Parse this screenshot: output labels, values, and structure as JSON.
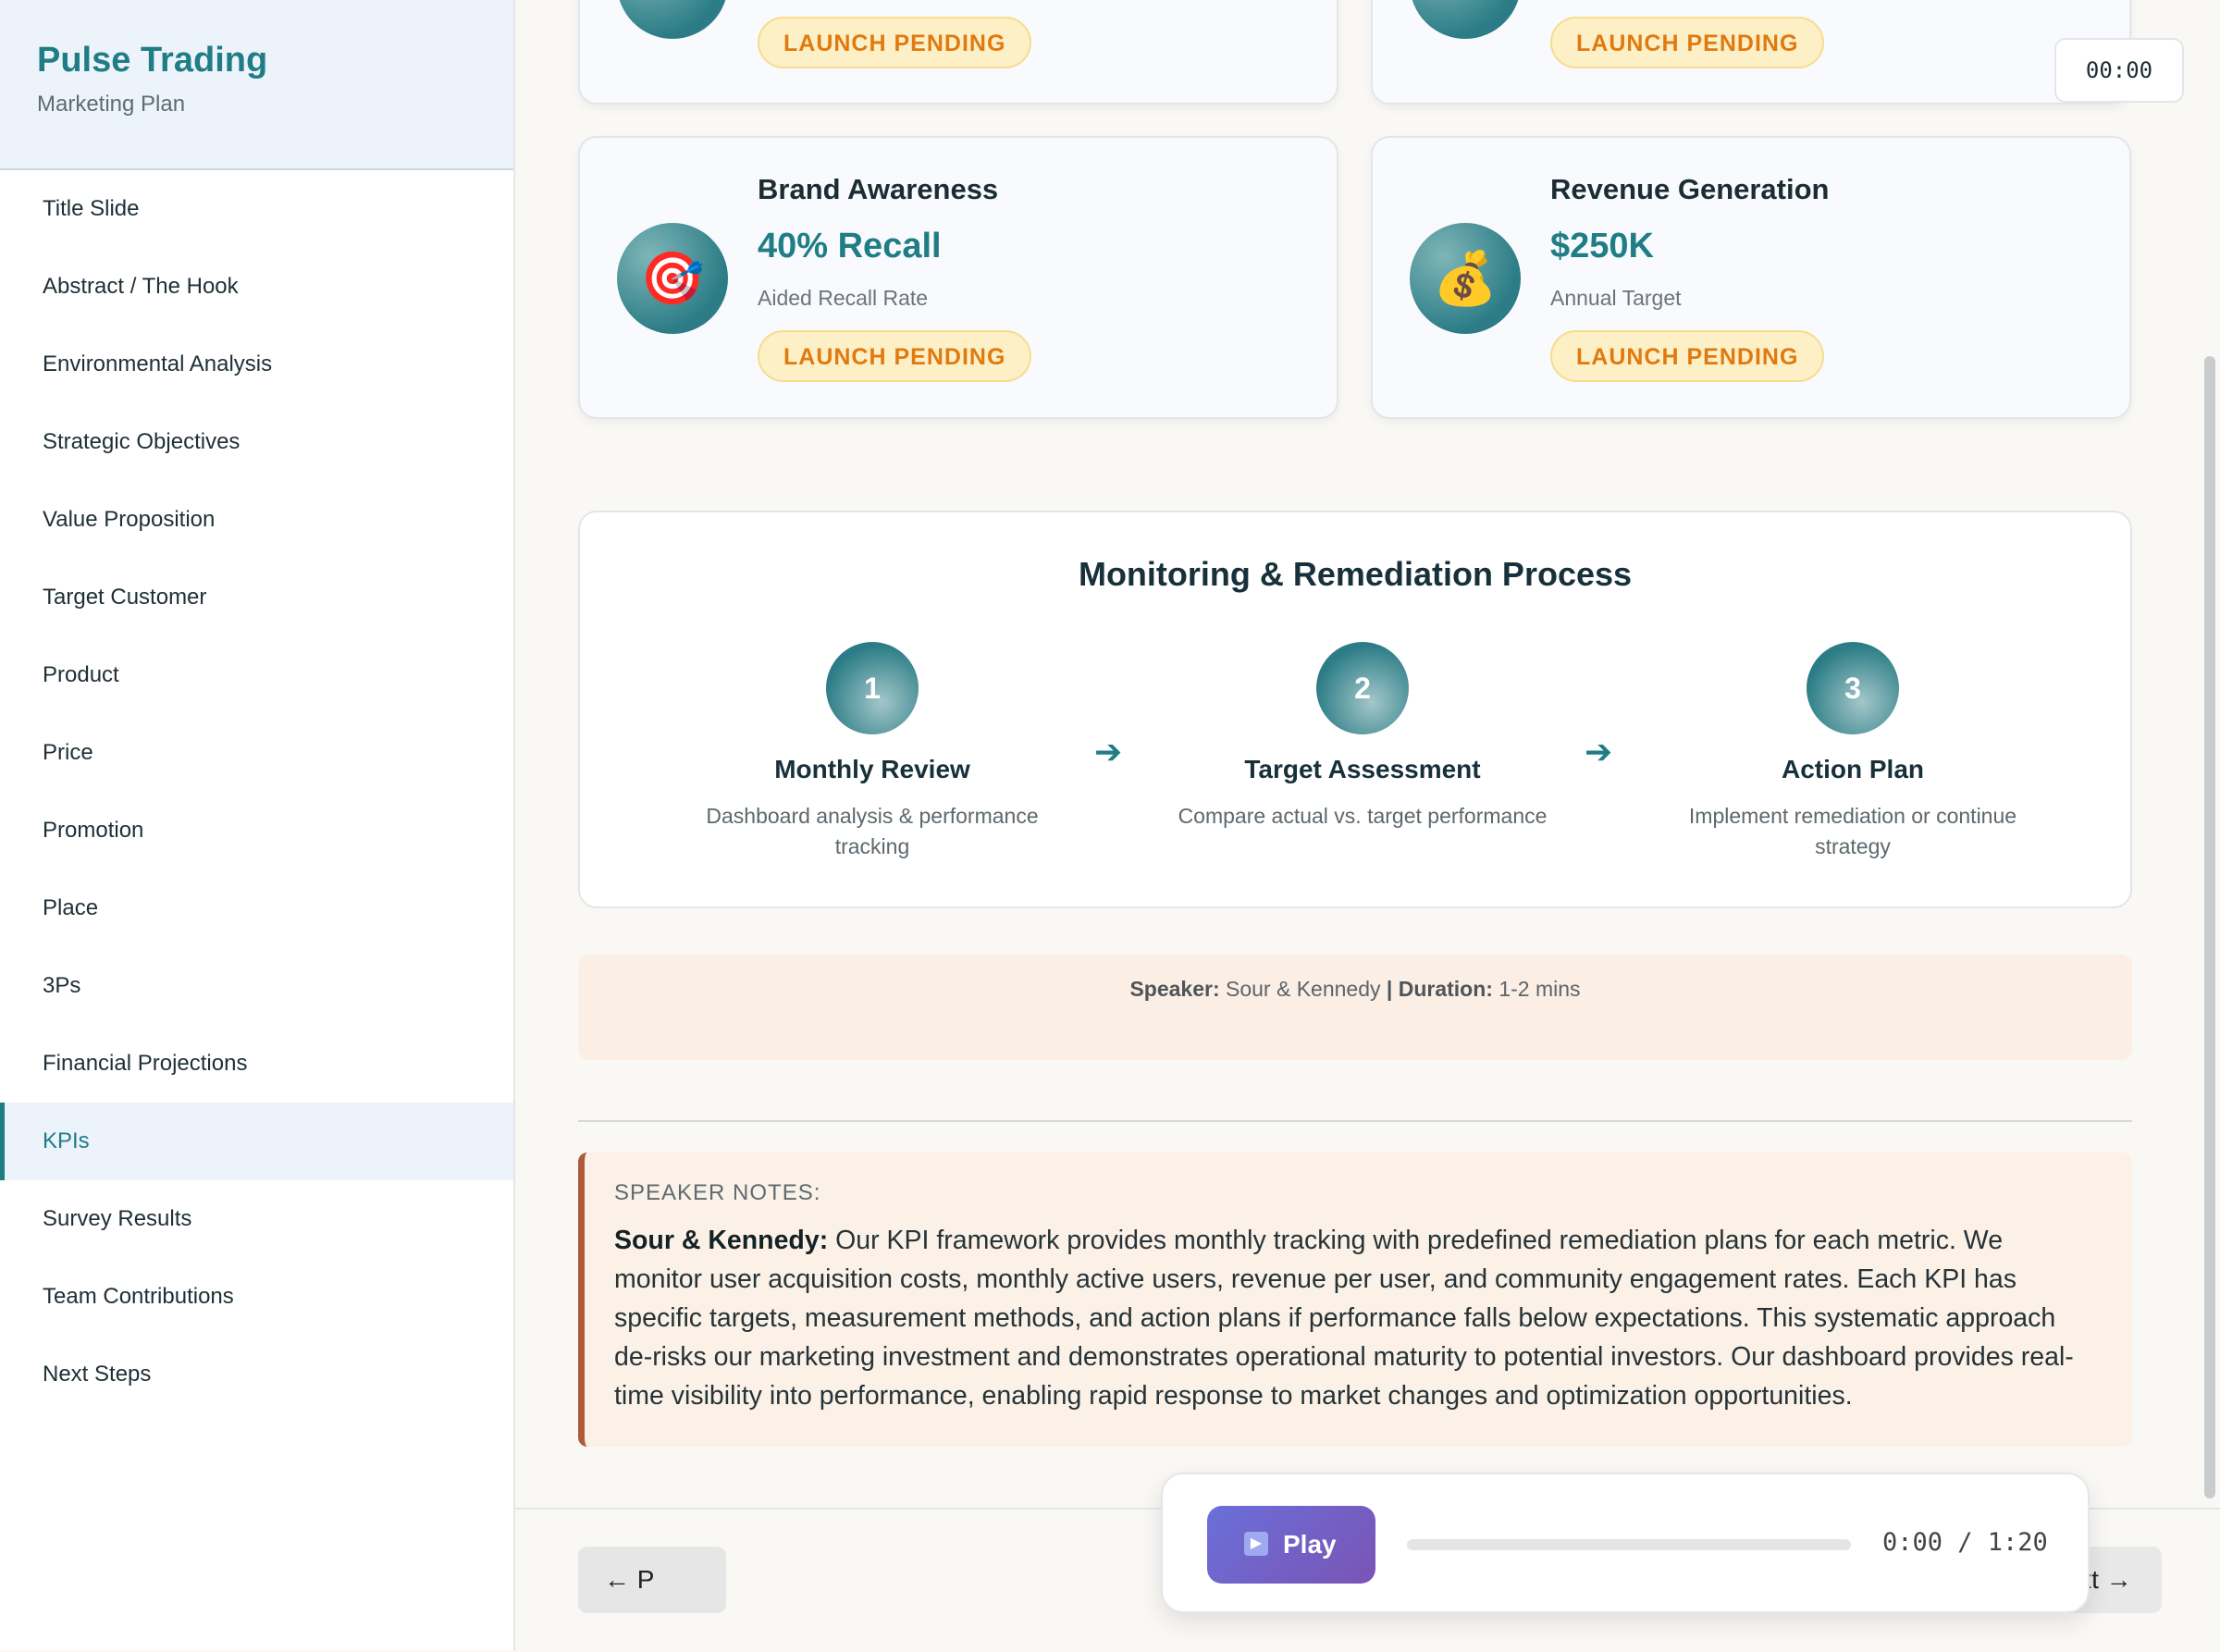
{
  "sidebar": {
    "title": "Pulse Trading",
    "subtitle": "Marketing Plan",
    "items": [
      {
        "label": "Title Slide"
      },
      {
        "label": "Abstract / The Hook"
      },
      {
        "label": "Environmental Analysis"
      },
      {
        "label": "Strategic Objectives"
      },
      {
        "label": "Value Proposition"
      },
      {
        "label": "Target Customer"
      },
      {
        "label": "Product"
      },
      {
        "label": "Price"
      },
      {
        "label": "Promotion"
      },
      {
        "label": "Place"
      },
      {
        "label": "3Ps"
      },
      {
        "label": "Financial Projections"
      },
      {
        "label": "KPIs"
      },
      {
        "label": "Survey Results"
      },
      {
        "label": "Team Contributions"
      },
      {
        "label": "Next Steps"
      }
    ],
    "active_item": "KPIs"
  },
  "timer": "00:00",
  "top_cards": [
    {
      "badge": "LAUNCH PENDING"
    },
    {
      "badge": "LAUNCH PENDING"
    }
  ],
  "kpi_cards": [
    {
      "title": "Brand Awareness",
      "value": "40% Recall",
      "sub": "Aided Recall Rate",
      "badge": "LAUNCH PENDING",
      "icon": "🎯",
      "icon_name": "target-icon"
    },
    {
      "title": "Revenue Generation",
      "value": "$250K",
      "sub": "Annual Target",
      "badge": "LAUNCH PENDING",
      "icon": "💰",
      "icon_name": "money-bag-icon"
    }
  ],
  "process": {
    "title": "Monitoring & Remediation Process",
    "steps": [
      {
        "num": "1",
        "title": "Monthly Review",
        "desc": "Dashboard analysis & performance tracking"
      },
      {
        "num": "2",
        "title": "Target Assessment",
        "desc": "Compare actual vs. target performance"
      },
      {
        "num": "3",
        "title": "Action Plan",
        "desc": "Implement remediation or continue strategy"
      }
    ],
    "arrow": "➔"
  },
  "speaker_info": {
    "speaker_label": "Speaker:",
    "speaker": "Sour & Kennedy",
    "separator": "|",
    "duration_label": "Duration:",
    "duration": "1-2 mins"
  },
  "notes": {
    "label": "SPEAKER NOTES:",
    "speaker": "Sour & Kennedy:",
    "text": "Our KPI framework provides monthly tracking with predefined remediation plans for each metric. We monitor user acquisition costs, monthly active users, revenue per user, and community engagement rates. Each KPI has specific targets, measurement methods, and action plans if performance falls below expectations. This systematic approach de-risks our marketing investment and demonstrates operational maturity to potential investors. Our dashboard provides real-time visibility into performance, enabling rapid response to market changes and optimization opportunities."
  },
  "nav": {
    "prev_label": "← P",
    "next_label": "Next →"
  },
  "player": {
    "play_label": "Play",
    "play_icon": "▶",
    "time": "0:00 / 1:20",
    "progress": 0
  },
  "colors": {
    "accent": "#1f7d86",
    "badge_text": "#e07a10",
    "badge_bg": "#fdf0c6",
    "play_gradient_start": "#6a6fd9",
    "play_gradient_end": "#7a54b5"
  }
}
